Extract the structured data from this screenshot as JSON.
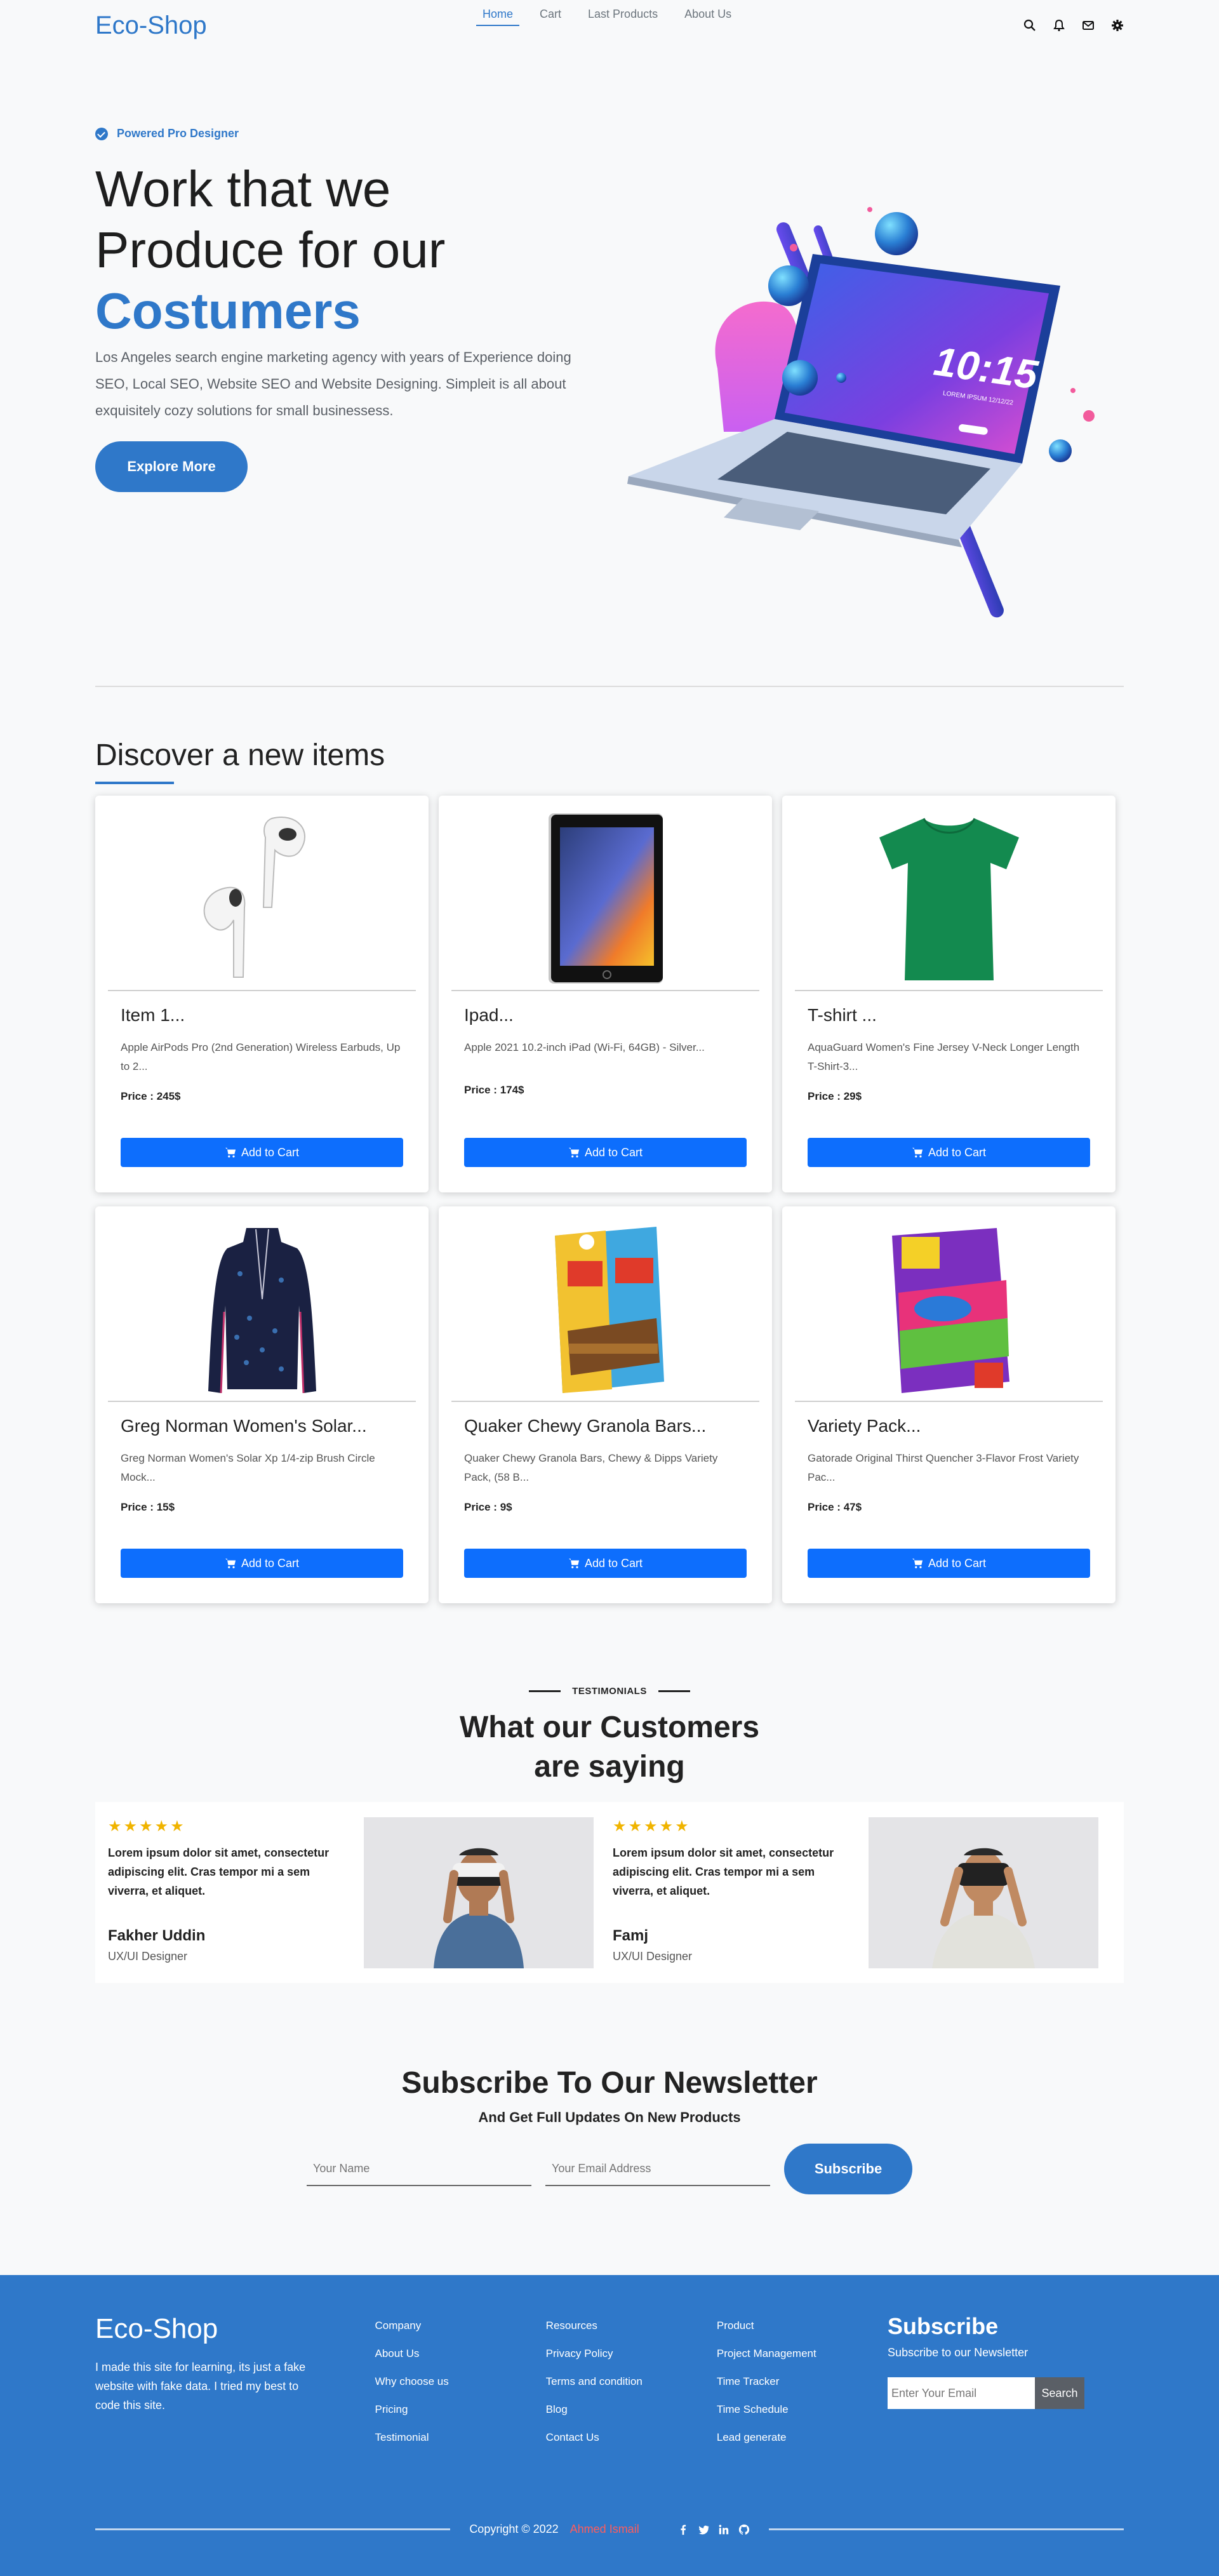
{
  "nav": {
    "brand": "Eco-Shop",
    "links": [
      "Home",
      "Cart",
      "Last Products",
      "About Us"
    ],
    "icons": [
      "search-icon",
      "bell-icon",
      "mail-icon",
      "gear-icon"
    ]
  },
  "hero": {
    "badge": "Powered Pro Designer",
    "title_line1": "Work that we",
    "title_line2": "Produce for our",
    "title_accent": "Costumers",
    "description": "Los Angeles search engine marketing agency with years of Experience doing SEO, Local SEO, Website SEO and Website Designing. Simpleit is all about exquisitely cozy solutions for small businessess.",
    "button": "Explore More",
    "illustration": {
      "time": "10:15",
      "sub": "LOREM IPSUM  12/12/22"
    }
  },
  "items": {
    "title": "Discover a new items",
    "button_label": "Add to Cart",
    "products": [
      {
        "title": "Item 1...",
        "desc": "Apple AirPods Pro (2nd Generation) Wireless Earbuds, Up to 2...",
        "price": "Price : 245$"
      },
      {
        "title": "Ipad...",
        "desc": "Apple 2021 10.2-inch iPad (Wi-Fi, 64GB) - Silver...",
        "price": "Price : 174$"
      },
      {
        "title": "T-shirt ...",
        "desc": "AquaGuard Women's Fine Jersey V-Neck Longer Length T-Shirt-3...",
        "price": "Price : 29$"
      },
      {
        "title": "Greg Norman Women's Solar...",
        "desc": "Greg Norman Women's Solar Xp 1/4-zip Brush Circle Mock...",
        "price": "Price : 15$"
      },
      {
        "title": "Quaker Chewy Granola Bars...",
        "desc": "Quaker Chewy Granola Bars, Chewy & Dipps Variety Pack, (58 B...",
        "price": "Price : 9$"
      },
      {
        "title": "Variety Pack...",
        "desc": "Gatorade Original Thirst Quencher 3-Flavor Frost Variety Pac...",
        "price": "Price : 47$"
      }
    ]
  },
  "testimonials": {
    "kicker": "TESTIMONIALS",
    "title_line1": "What our Customers",
    "title_line2": "are saying",
    "entries": [
      {
        "stars": "★★★★★",
        "quote": "Lorem ipsum dolor sit amet, consectetur adipiscing elit. Cras tempor mi a sem viverra, et aliquet.",
        "name": "Fakher Uddin",
        "role": "UX/UI Designer"
      },
      {
        "stars": "★★★★★",
        "quote": "Lorem ipsum dolor sit amet, consectetur adipiscing elit. Cras tempor mi a sem viverra, et aliquet.",
        "name": "Famj",
        "role": "UX/UI Designer"
      }
    ]
  },
  "newsletter": {
    "title": "Subscribe To Our Newsletter",
    "subtitle": "And Get Full Updates On New Products",
    "name_placeholder": "Your Name",
    "email_placeholder": "Your Email Address",
    "button": "Subscribe"
  },
  "footer": {
    "brand": "Eco-Shop",
    "about": "I made this site for learning, its just a fake website with fake data. I tried my best to code this site.",
    "col1": [
      "Company",
      "About Us",
      "Why choose us",
      "Pricing",
      "Testimonial"
    ],
    "col2": [
      "Resources",
      "Privacy Policy",
      "Terms and condition",
      "Blog",
      "Contact Us"
    ],
    "col3": [
      "Product",
      "Project Management",
      "Time Tracker",
      "Time Schedule",
      "Lead generate"
    ],
    "subscribe_title": "Subscribe",
    "subscribe_sub": "Subscribe to our Newsletter",
    "email_placeholder": "Enter Your Email",
    "search_button": "Search",
    "copyright": "Copyright © 2022",
    "author": "Ahmed Ismail",
    "socials": [
      "facebook-icon",
      "twitter-icon",
      "linkedin-icon",
      "github-icon"
    ]
  },
  "colors": {
    "accent": "#2f78c9",
    "button": "#0d6efd",
    "star": "#f0b400",
    "author": "#ff5c5c"
  }
}
